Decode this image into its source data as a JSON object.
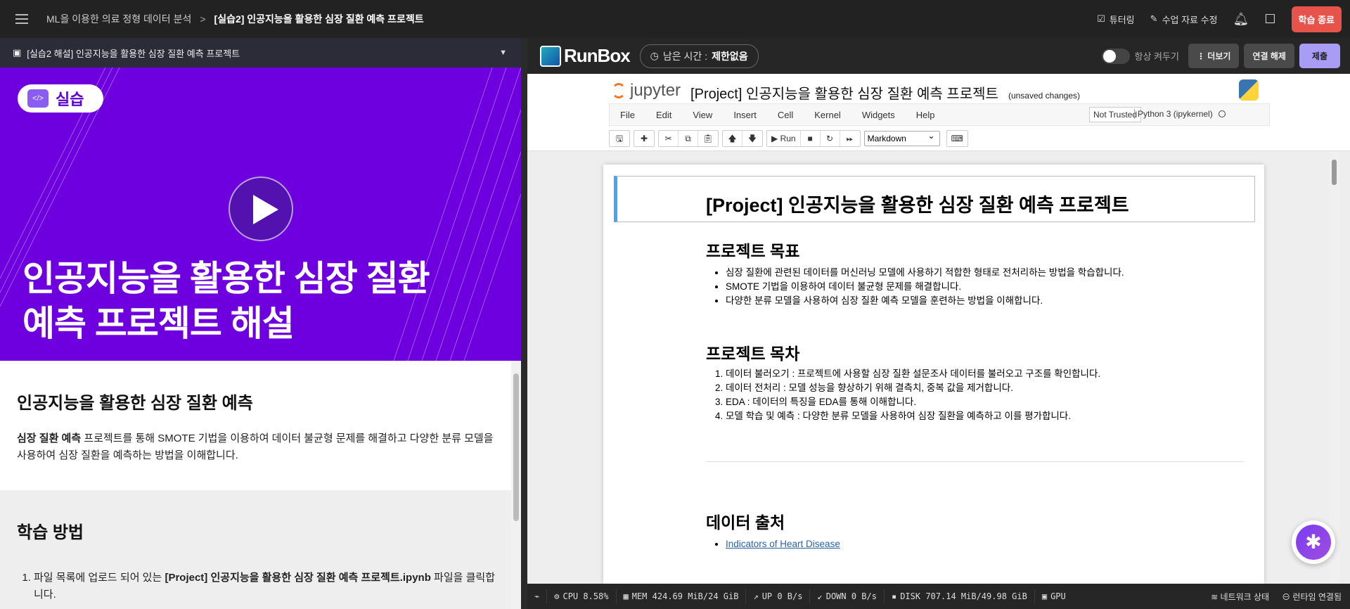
{
  "topbar": {
    "breadcrumb_course": "ML을 이용한 의료 정형 데이터 분석",
    "breadcrumb_separator": ">",
    "breadcrumb_current": "[실습2] 인공지능을 활용한 심장 질환 예측 프로젝트",
    "tutoring": "튜터링",
    "edit_material": "수업 자료 수정",
    "end_learning": "학습 종료"
  },
  "left": {
    "header_title": "[실습2 해설] 인공지능을 활용한 심장 질환 예측 프로젝트",
    "video": {
      "badge": "실습",
      "badge_icon": "</>",
      "title_line1": "인공지능을 활용한 심장 질환",
      "title_line2": "예측 프로젝트 해설",
      "bg_color": "#6e00e0"
    },
    "intro": {
      "heading": "인공지능을 활용한 심장 질환 예측",
      "bold": "심장 질환 예측",
      "text": " 프로젝트를 통해 SMOTE 기법을 이용하여 데이터 불균형 문제를 해결하고 다양한 분류 모델을 사용하여 심장 질환을 예측하는 방법을 이해합니다."
    },
    "method": {
      "heading": "학습 방법",
      "step1_pre": "파일 목록에 업로드 되어 있는 ",
      "step1_bold": "[Project] 인공지능을 활용한 심장 질환 예측 프로젝트.ipynb",
      "step1_post": " 파일을 클릭합니다."
    }
  },
  "runbox": {
    "logo": "RunBox",
    "timer_label": "남은 시간 :",
    "timer_value": "제한없음",
    "always_on": "항상 켜두기",
    "more": "더보기",
    "disconnect": "연결 해제",
    "submit": "제출"
  },
  "jupyter": {
    "logo": "jupyter",
    "notebook_name": "[Project] 인공지능을 활용한 심장 질환 예측 프로젝트",
    "unsaved": "(unsaved changes)",
    "menu": [
      "File",
      "Edit",
      "View",
      "Insert",
      "Cell",
      "Kernel",
      "Widgets",
      "Help"
    ],
    "trust": "Not Trusted",
    "kernel": "Python 3 (ipykernel)",
    "run": "Run",
    "cell_type": "Markdown"
  },
  "notebook": {
    "title": "[Project] 인공지능을 활용한 심장 질환 예측 프로젝트",
    "goal_heading": "프로젝트 목표",
    "goals": [
      "심장 질환에 관련된 데이터를 머신러닝 모델에 사용하기 적합한 형태로 전처리하는 방법을 학습합니다.",
      "SMOTE 기법을 이용하여 데이터 불균형 문제를 해결합니다.",
      "다양한 분류 모델을 사용하여 심장 질환 예측 모델을 훈련하는 방법을 이해합니다."
    ],
    "toc_heading": "프로젝트 목차",
    "toc": [
      "데이터 불러오기 : 프로젝트에 사용할 심장 질환 설문조사 데이터를 불러오고 구조를 확인합니다.",
      "데이터 전처리 : 모델 성능을 향상하기 위해 결측치, 중복 값을 제거합니다.",
      "EDA : 데이터의 특징을 EDA를 통해 이해합니다.",
      "모델 학습 및 예측 : 다양한 분류 모델을 사용하여 심장 질환을 예측하고 이를 평가합니다."
    ],
    "source_heading": "데이터 출처",
    "source_link": "Indicators of Heart Disease"
  },
  "status": {
    "cpu": "CPU 8.58%",
    "mem": "MEM 424.69 MiB/24 GiB",
    "up": "UP 0 B/s",
    "down": "DOWN 0 B/s",
    "disk": "DISK 707.14 MiB/49.98 GiB",
    "gpu": "GPU",
    "network": "네트워크 상태",
    "runtime": "런타임 연결됨"
  }
}
